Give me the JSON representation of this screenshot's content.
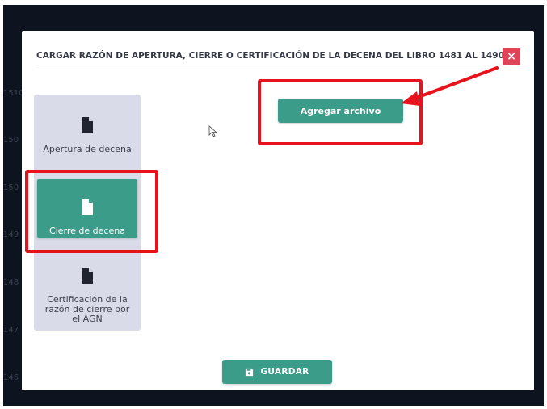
{
  "modal": {
    "title": "CARGAR RAZÓN DE APERTURA, CIERRE O CERTIFICACIÓN DE LA DECENA DEL LIBRO 1481 AL 1490",
    "close_icon": "×"
  },
  "sidebar": {
    "items": [
      {
        "label": "Apertura de decena",
        "icon": "document-icon",
        "active": false
      },
      {
        "label": "Cierre de decena",
        "icon": "document-icon",
        "active": true
      },
      {
        "label": "Certificación de la razón de cierre por el AGN",
        "icon": "document-icon",
        "active": false
      }
    ]
  },
  "actions": {
    "add_file_label": "Agregar archivo",
    "save_label": "GUARDAR",
    "save_icon": "floppy-disk-icon"
  },
  "background_numbers": [
    "1510",
    "150",
    "150",
    "149",
    "148",
    "147",
    "146"
  ],
  "colors": {
    "accent": "#3c9c8a",
    "close": "#e04358",
    "highlight": "#e8121c",
    "panel": "#d9dce8",
    "backdrop": "#0e1320"
  }
}
